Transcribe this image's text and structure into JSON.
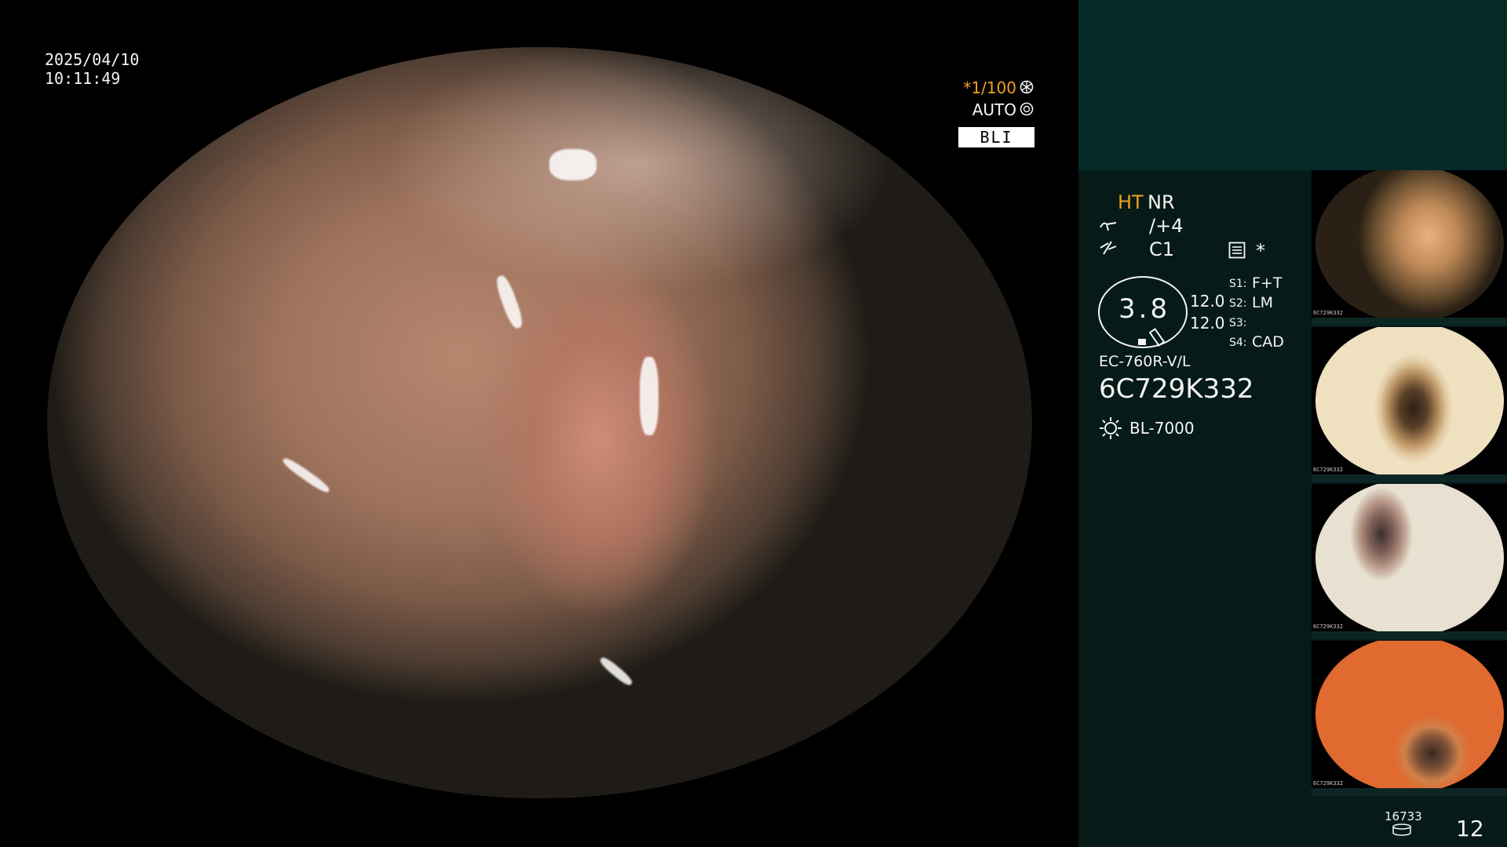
{
  "datetime": {
    "date": "2025/04/10",
    "time": "10:11:49"
  },
  "overlay": {
    "shutter": "*1/100",
    "shutter_icon": "shutter-icon",
    "iris": "AUTO",
    "iris_icon": "iris-icon",
    "mode": "BLI"
  },
  "panel": {
    "ht": "HT",
    "nr": "NR",
    "enhance": "/+4",
    "color": "C1",
    "asterisk": "*",
    "gauge_value": "3.8",
    "gauge_top": "12.0",
    "gauge_bottom": "12.0",
    "s1_label": "S1:",
    "s1_value": "F+T",
    "s2_label": "S2:",
    "s2_value": "LM",
    "s3_label": "S3:",
    "s3_value": "",
    "s4_label": "S4:",
    "s4_value": "CAD",
    "scope_model": "EC-760R-V/L",
    "serial": "6C729K332",
    "light_source": "BL-7000",
    "image_count_small": "16733",
    "image_count": "12",
    "colors": {
      "accent": "#f0a020",
      "panel_bg": "#061a18",
      "panel_top": "#062a28"
    }
  },
  "thumbnails": [
    {
      "caption": "6C729K332"
    },
    {
      "caption": "6C729K332"
    },
    {
      "caption": "6C729K332"
    },
    {
      "caption": "6C729K332"
    }
  ]
}
